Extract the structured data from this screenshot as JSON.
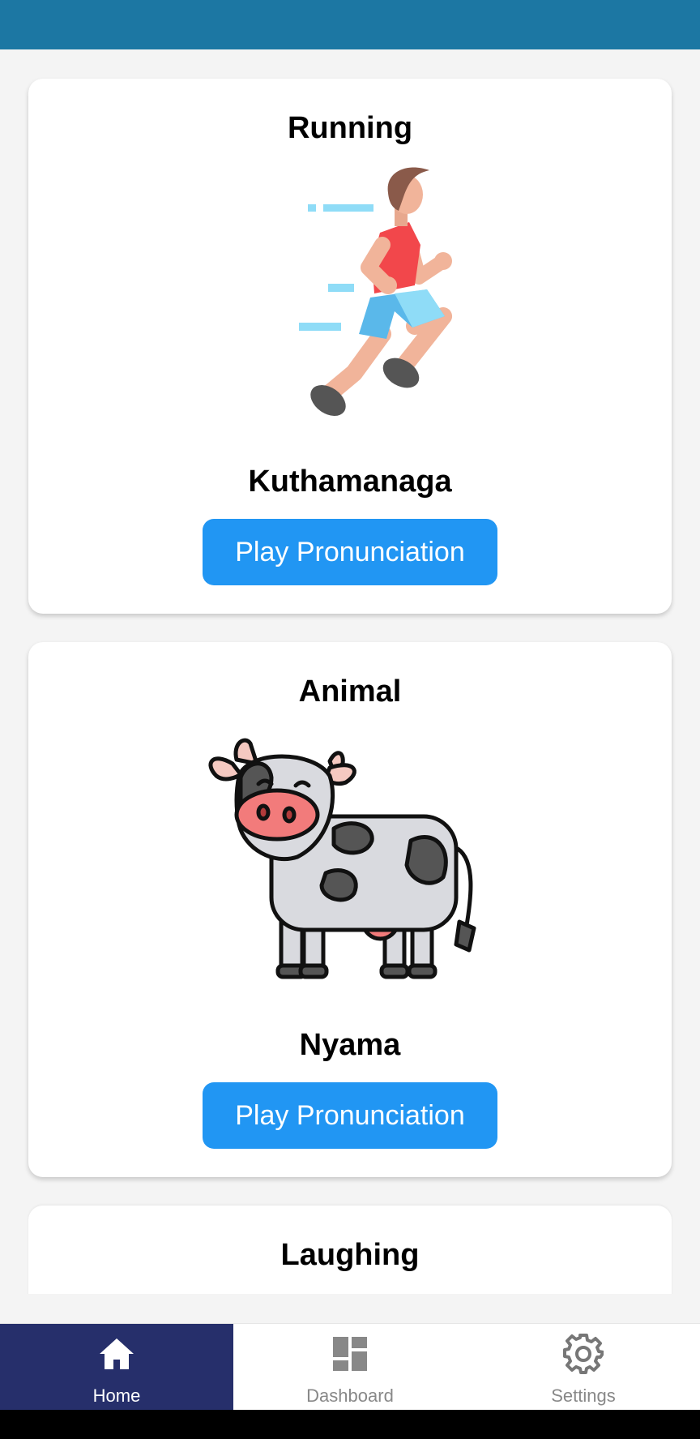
{
  "colors": {
    "header": "#1c77a3",
    "accent_button": "#2196f3",
    "nav_active": "#262f6b",
    "background": "#f4f4f4"
  },
  "cards": [
    {
      "title": "Running",
      "illustration": "running-person-icon",
      "word": "Kuthamanaga",
      "button_label": "Play Pronunciation"
    },
    {
      "title": "Animal",
      "illustration": "cow-icon",
      "word": "Nyama",
      "button_label": "Play Pronunciation"
    },
    {
      "title": "Laughing"
    }
  ],
  "bottom_nav": {
    "items": [
      {
        "label": "Home",
        "icon": "home-icon",
        "active": true
      },
      {
        "label": "Dashboard",
        "icon": "dashboard-icon",
        "active": false
      },
      {
        "label": "Settings",
        "icon": "gear-icon",
        "active": false
      }
    ]
  }
}
